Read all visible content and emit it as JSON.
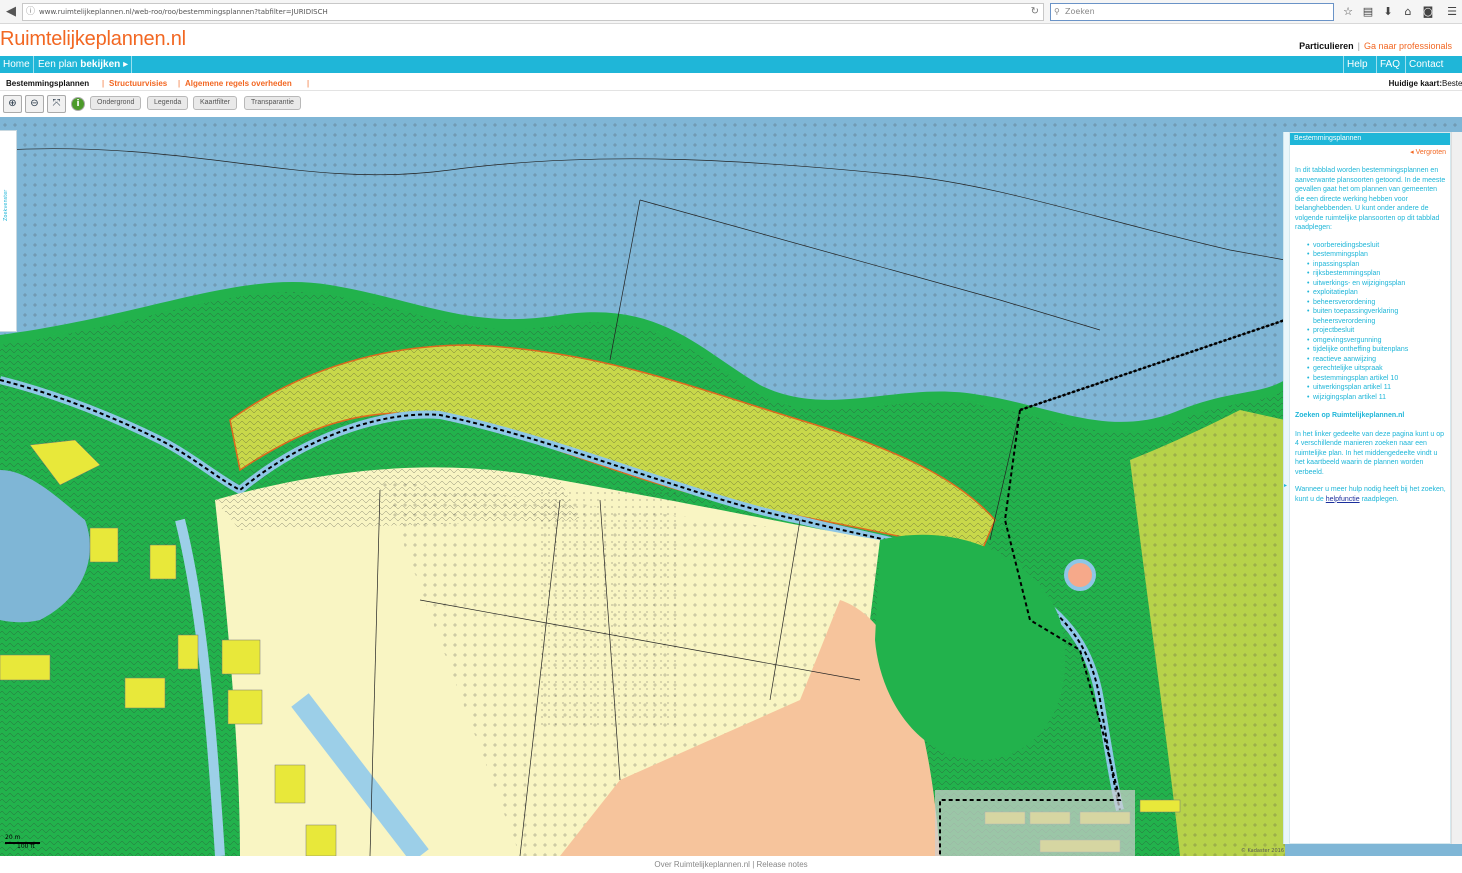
{
  "browser": {
    "url": "www.ruimtelijkeplannen.nl/web-roo/roo/bestemmingsplannen?tabfilter=JURIDISCH",
    "search_placeholder": "Zoeken"
  },
  "site": {
    "logo": "Ruimtelijkeplannen.nl",
    "audience_active": "Particulieren",
    "audience_other": "Ga naar professionals"
  },
  "nav": {
    "home": "Home",
    "plan_prefix": "Een plan",
    "plan_bold": "bekijken",
    "help": "Help",
    "faq": "FAQ",
    "contact": "Contact"
  },
  "tabs": {
    "bestemmingsplannen": "Bestemmingsplannen",
    "structuurvisies": "Structuurvisies",
    "algemene_regels": "Algemene regels overheden",
    "huidige_kaart_label": "Huidige kaart:",
    "huidige_kaart_value": "Bestemmingsplannen"
  },
  "toolbar": {
    "ondergrond": "Ondergrond",
    "legenda": "Legenda",
    "kaartfilter": "Kaartfilter",
    "transparantie": "Transparantie"
  },
  "map": {
    "zoekvenster": "Zoekvenster",
    "scale_m": "20 m",
    "scale_ft": "100 ft",
    "copyright": "© Kadaster 2016"
  },
  "panel": {
    "title": "Bestemmingsplannen",
    "vergroten": "Vergroten",
    "intro": "In dit tabblad worden bestemmingsplannen en aanverwante plansoorten getoond. In de meeste gevallen gaat het om plannen van gemeenten die een directe werking hebben voor belanghebbenden. U kunt onder andere de volgende ruimtelijke plansoorten op dit tabblad raadplegen:",
    "plantypes": [
      "voorbereidingsbesluit",
      "bestemmingsplan",
      "inpassingsplan",
      "rijksbestemmingsplan",
      "uitwerkings- en wijzigingsplan",
      "exploitatieplan",
      "beheersverordening",
      "buiten toepassingverklaring beheersverordening",
      "projectbesluit",
      "omgevingsvergunning",
      "tijdelijke ontheffing buitenplans",
      "reactieve aanwijzing",
      "gerechtelijke uitspraak",
      "bestemmingsplan artikel 10",
      "uitwerkingsplan artikel 11",
      "wijzigingsplan artikel 11"
    ],
    "zoeken_heading": "Zoeken op Ruimtelijkeplannen.nl",
    "zoeken_text": "In het linker gedeelte van deze pagina kunt u op 4 verschillende manieren zoeken naar een ruimtelijke plan. In het middengedeelte vindt u het kaartbeeld waarin de plannen worden verbeeld.",
    "help_text_before": "Wanneer u meer hulp nodig heeft bij het zoeken, kunt u de",
    "help_link": "helpfunctie",
    "help_text_after": "raadplegen."
  },
  "footer": {
    "over": "Over Ruimtelijkeplannen.nl",
    "sep": "|",
    "release": "Release notes"
  },
  "colors": {
    "brand_orange": "#f26722",
    "nav_cyan": "#1fb6d8",
    "water_blue": "#7fb6d6",
    "green": "#22b24c",
    "light_green": "#b7d24a",
    "yellow_plan": "#f9f5c3",
    "salmon": "#f6c49c"
  }
}
